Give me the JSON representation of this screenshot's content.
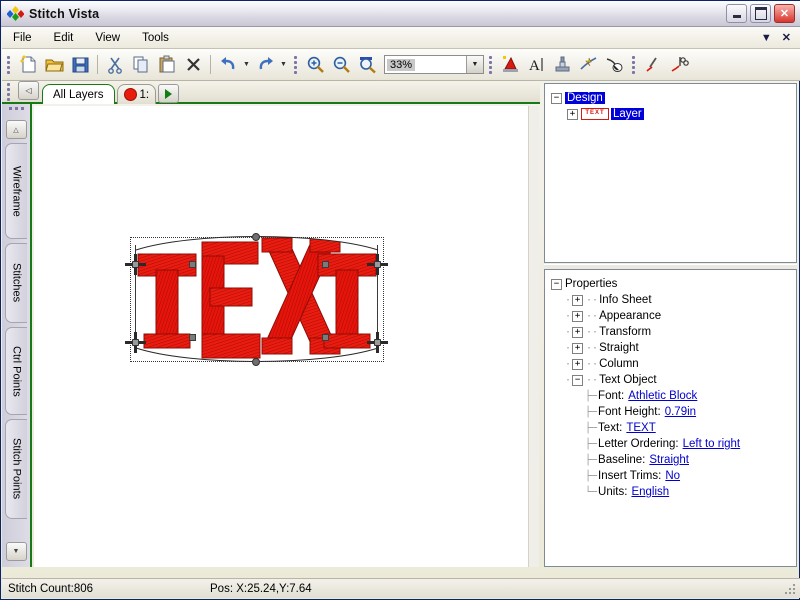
{
  "window": {
    "title": "Stitch Vista",
    "icon": "app-diamonds-icon",
    "minimize": "minimize-icon",
    "maximize": "maximize-icon",
    "close": "close-icon"
  },
  "menubar": {
    "items": [
      {
        "label": "File"
      },
      {
        "label": "Edit"
      },
      {
        "label": "View"
      },
      {
        "label": "Tools"
      }
    ],
    "overflow_icon": "chevron-down-icon",
    "close_icon": "close-icon"
  },
  "toolbar": {
    "buttons": [
      {
        "name": "new-document-button",
        "icon": "new-document-icon"
      },
      {
        "name": "open-file-button",
        "icon": "open-folder-icon"
      },
      {
        "name": "save-button",
        "icon": "floppy-disk-icon"
      },
      {
        "name": "cut-button",
        "icon": "scissors-icon"
      },
      {
        "name": "copy-button",
        "icon": "copy-icon"
      },
      {
        "name": "paste-button",
        "icon": "clipboard-icon"
      },
      {
        "name": "delete-button",
        "icon": "x-cross-icon"
      },
      {
        "name": "undo-button",
        "icon": "undo-arrow-icon"
      },
      {
        "name": "redo-button",
        "icon": "redo-arrow-icon"
      },
      {
        "name": "zoom-in-button",
        "icon": "magnifier-plus-icon"
      },
      {
        "name": "zoom-out-button",
        "icon": "magnifier-minus-icon"
      },
      {
        "name": "zoom-window-button",
        "icon": "magnifier-window-icon"
      },
      {
        "name": "color-fill-button",
        "icon": "paint-bucket-icon"
      },
      {
        "name": "text-tool-button",
        "icon": "text-a-icon"
      },
      {
        "name": "stamp-tool-button",
        "icon": "stamp-icon"
      },
      {
        "name": "lightning-tool-button",
        "icon": "lightning-icon"
      },
      {
        "name": "bulb-tool-button",
        "icon": "bulb-icon"
      },
      {
        "name": "needle-tool-button",
        "icon": "needle-icon"
      },
      {
        "name": "trim-tool-button",
        "icon": "needle-scissors-icon"
      }
    ],
    "zoom": {
      "value": "33%",
      "placeholder": "33%",
      "dropdown_icon": "chevron-down-icon"
    }
  },
  "layer_tabs": {
    "scroll_left_icon": "triangle-left-icon",
    "tabs": [
      {
        "label": "All Layers",
        "name": "tab-all-layers",
        "active": true
      },
      {
        "label": "1:",
        "name": "tab-layer-1",
        "active": false,
        "swatch": "#e81b0d"
      }
    ],
    "play_button_icon": "play-triangle-icon"
  },
  "side_tabs": {
    "up_icon": "triangle-up-icon",
    "down_icon": "triangle-down-icon",
    "items": [
      {
        "label": "Wireframe",
        "name": "side-tab-wireframe"
      },
      {
        "label": "Stitches",
        "name": "side-tab-stitches"
      },
      {
        "label": "Ctrl Points",
        "name": "side-tab-ctrl-points"
      },
      {
        "label": "Stitch Points",
        "name": "side-tab-stitch-points"
      }
    ]
  },
  "canvas": {
    "artwork_text": "TEXT",
    "artwork_color": "#e8140b",
    "selection": "envelope-with-handles"
  },
  "design_tree": {
    "root": {
      "label": "Design",
      "expander": "−",
      "selected": true
    },
    "child": {
      "label": "Layer",
      "expander": "+",
      "selected": true,
      "icon": "text-object-icon"
    }
  },
  "properties": {
    "title": "Properties",
    "expander": "−",
    "groups": [
      {
        "label": "Info Sheet",
        "expander": "+"
      },
      {
        "label": "Appearance",
        "expander": "+"
      },
      {
        "label": "Transform",
        "expander": "+"
      },
      {
        "label": "Straight",
        "expander": "+"
      },
      {
        "label": "Column",
        "expander": "+"
      },
      {
        "label": "Text Object",
        "expander": "−"
      }
    ],
    "text_object": [
      {
        "label": "Font:",
        "value": "Athletic Block"
      },
      {
        "label": "Font Height:",
        "value": "0.79in"
      },
      {
        "label": "Text:",
        "value": "TEXT"
      },
      {
        "label": "Letter Ordering:",
        "value": "Left to right"
      },
      {
        "label": "Baseline:",
        "value": "Straight"
      },
      {
        "label": "Insert Trims:",
        "value": "No"
      },
      {
        "label": "Units:",
        "value": "English"
      }
    ],
    "link_color": "#0000cc"
  },
  "statusbar": {
    "stitch_count": "Stitch Count:806",
    "position": "Pos:  X:25.24,Y:7.64"
  }
}
